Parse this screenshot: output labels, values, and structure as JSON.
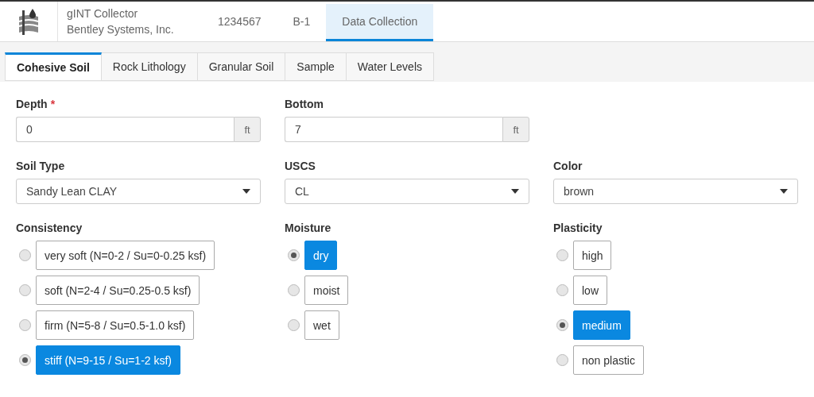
{
  "header": {
    "app_name": "gINT Collector",
    "company": "Bentley Systems, Inc.",
    "nav": [
      {
        "label": "1234567",
        "selected": false
      },
      {
        "label": "B-1",
        "selected": false
      },
      {
        "label": "Data Collection",
        "selected": true
      }
    ]
  },
  "tabs": [
    {
      "label": "Cohesive Soil",
      "selected": true
    },
    {
      "label": "Rock Lithology",
      "selected": false
    },
    {
      "label": "Granular Soil",
      "selected": false
    },
    {
      "label": "Sample",
      "selected": false
    },
    {
      "label": "Water Levels",
      "selected": false
    }
  ],
  "fields": [
    {
      "kind": "input",
      "label": "Depth",
      "required_mark": "*",
      "value": "0",
      "unit": "ft"
    },
    {
      "kind": "input",
      "label": "Bottom",
      "value": "7",
      "unit": "ft"
    },
    {
      "kind": "blank"
    },
    {
      "kind": "select",
      "label": "Soil Type",
      "value": "Sandy Lean CLAY"
    },
    {
      "kind": "select",
      "label": "USCS",
      "value": "CL"
    },
    {
      "kind": "select",
      "label": "Color",
      "value": "brown"
    }
  ],
  "radio_groups": [
    {
      "label": "Consistency",
      "options": [
        {
          "label": "very soft (N=0-2 / Su=0-0.25 ksf)",
          "selected": false
        },
        {
          "label": "soft (N=2-4 / Su=0.25-0.5 ksf)",
          "selected": false
        },
        {
          "label": "firm (N=5-8 / Su=0.5-1.0 ksf)",
          "selected": false
        },
        {
          "label": "stiff (N=9-15 / Su=1-2 ksf)",
          "selected": true
        }
      ]
    },
    {
      "label": "Moisture",
      "options": [
        {
          "label": "dry",
          "selected": true
        },
        {
          "label": "moist",
          "selected": false
        },
        {
          "label": "wet",
          "selected": false
        }
      ]
    },
    {
      "label": "Plasticity",
      "options": [
        {
          "label": "high",
          "selected": false
        },
        {
          "label": "low",
          "selected": false
        },
        {
          "label": "medium",
          "selected": true
        },
        {
          "label": "non plastic",
          "selected": false
        }
      ]
    }
  ]
}
